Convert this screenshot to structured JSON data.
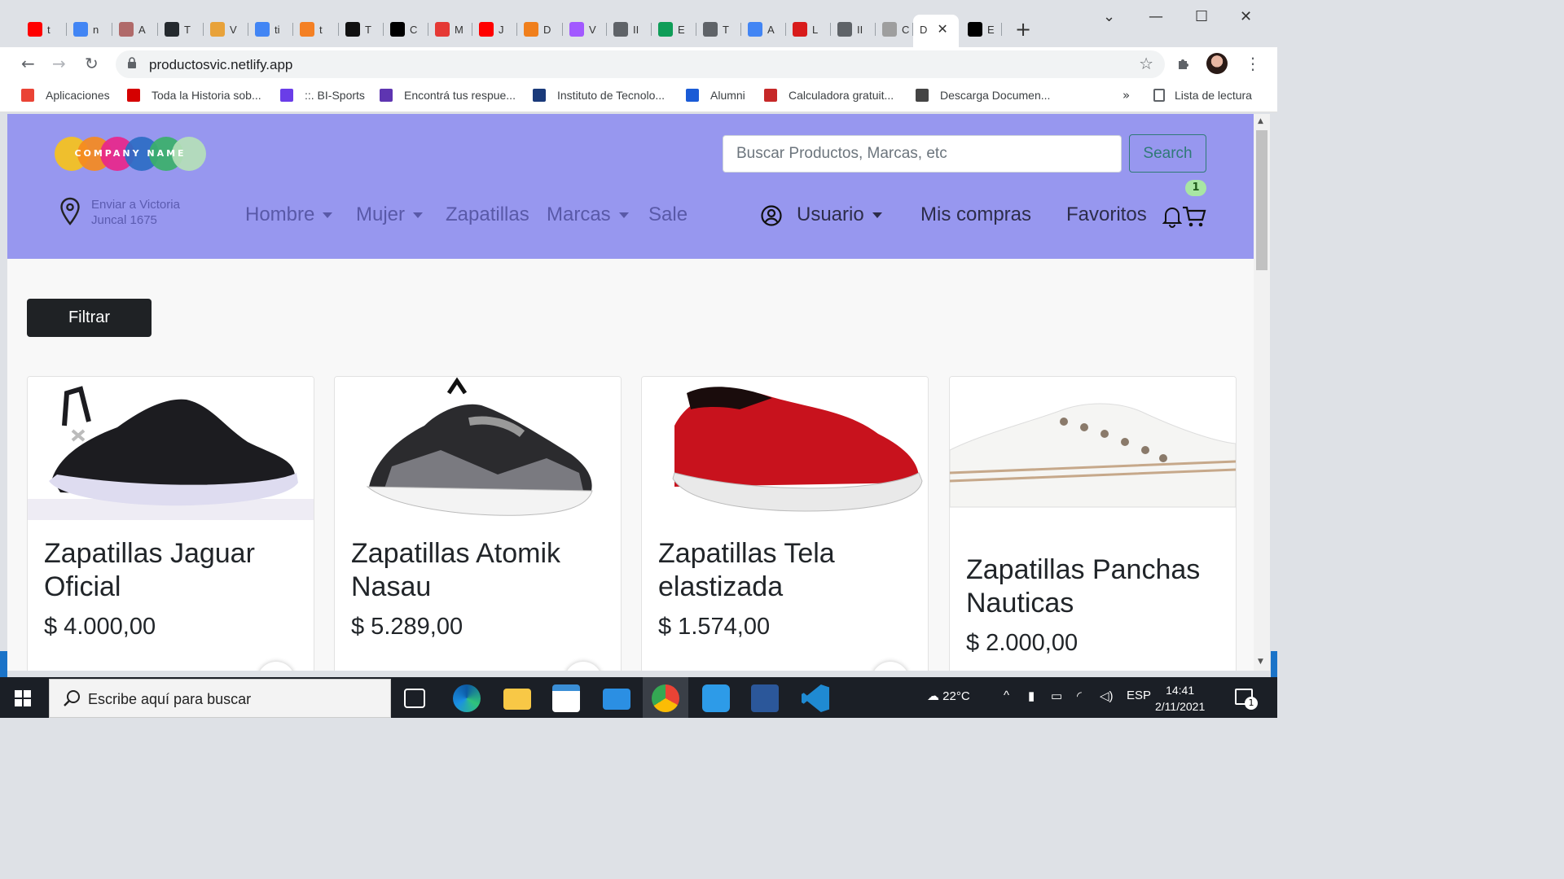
{
  "browser": {
    "tabs": [
      {
        "label": "t",
        "icon": "youtube-icon",
        "color": "#ff0000"
      },
      {
        "label": "n",
        "icon": "google-icon",
        "color": "#4285f4"
      },
      {
        "label": "A",
        "icon": "app-icon",
        "color": "#b06a6a"
      },
      {
        "label": "T",
        "icon": "github-icon",
        "color": "#24292e"
      },
      {
        "label": "V",
        "icon": "notes-icon",
        "color": "#e8a23a"
      },
      {
        "label": "ti",
        "icon": "google-icon",
        "color": "#4285f4"
      },
      {
        "label": "t",
        "icon": "stackoverflow-icon",
        "color": "#f48024"
      },
      {
        "label": "T",
        "icon": "p5-icon",
        "color": "#111111"
      },
      {
        "label": "C",
        "icon": "dev-icon",
        "color": "#000000"
      },
      {
        "label": "M",
        "icon": "record-icon",
        "color": "#e53935"
      },
      {
        "label": "J",
        "icon": "youtube-icon",
        "color": "#ff0000"
      },
      {
        "label": "D",
        "icon": "app-icon",
        "color": "#f07f1c"
      },
      {
        "label": "V",
        "icon": "figma-icon",
        "color": "#a259ff"
      },
      {
        "label": "II",
        "icon": "globe-icon",
        "color": "#5f6368"
      },
      {
        "label": "E",
        "icon": "drive-icon",
        "color": "#0f9d58"
      },
      {
        "label": "T",
        "icon": "globe-icon",
        "color": "#5f6368"
      },
      {
        "label": "A",
        "icon": "google-icon",
        "color": "#4285f4"
      },
      {
        "label": "L",
        "icon": "app-icon",
        "color": "#d81b1b"
      },
      {
        "label": "II",
        "icon": "globe-icon",
        "color": "#5f6368"
      },
      {
        "label": "C",
        "icon": "doc-icon",
        "color": "#9e9e9e"
      },
      {
        "label": "D",
        "icon": "page-icon",
        "color": "#ffffff"
      },
      {
        "label": "E",
        "icon": "terminal-icon",
        "color": "#000000"
      }
    ],
    "url": "productosvic.netlify.app",
    "bookmarks": [
      {
        "label": "Aplicaciones",
        "color": "#ea4335"
      },
      {
        "label": "Toda la Historia sob...",
        "color": "#d50000"
      },
      {
        "label": "::. BI-Sports",
        "color": "#6a3de8"
      },
      {
        "label": "Encontrá tus respue...",
        "color": "#5e35b1"
      },
      {
        "label": "Instituto de Tecnolo...",
        "color": "#1a3a7a"
      },
      {
        "label": "Alumni",
        "color": "#1a5bd6"
      },
      {
        "label": "Calculadora gratuit...",
        "color": "#c62828"
      },
      {
        "label": "Descarga Documen...",
        "color": "#444444"
      }
    ],
    "bookmarks_more": "»",
    "reading_list": "Lista de lectura"
  },
  "site": {
    "logo_text": "COMPANY NAME",
    "search_placeholder": "Buscar Productos, Marcas, etc",
    "search_button": "Search",
    "location_line1": "Enviar a Victoria",
    "location_line2": "Juncal 1675",
    "nav": {
      "hombre": "Hombre",
      "mujer": "Mujer",
      "zapatillas": "Zapatillas",
      "marcas": "Marcas",
      "sale": "Sale",
      "usuario": "Usuario",
      "mis_compras": "Mis compras",
      "favoritos": "Favoritos"
    },
    "cart_badge": "1",
    "filter_button": "Filtrar",
    "products": [
      {
        "title": "Zapatillas Jaguar Oficial",
        "price": "$ 4.000,00"
      },
      {
        "title": "Zapatillas Atomik Nasau",
        "price": "$ 5.289,00"
      },
      {
        "title": "Zapatillas Tela elastizada",
        "price": "$ 1.574,00"
      },
      {
        "title": "Zapatillas Panchas Nauticas",
        "price": "$ 2.000,00"
      }
    ],
    "colors": {
      "header_bg": "#9797ef",
      "nav_text": "#5959a8",
      "search_accent": "#2f7a77",
      "badge": "#a8e6a3"
    }
  },
  "taskbar": {
    "search_placeholder": "Escribe aquí para buscar",
    "weather": "22°C",
    "language": "ESP",
    "time": "14:41",
    "date": "2/11/2021",
    "notification_count": "1"
  }
}
